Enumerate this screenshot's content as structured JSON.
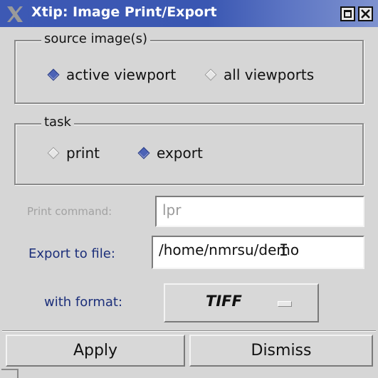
{
  "window": {
    "title": "Xtip: Image Print/Export",
    "icons": {
      "app": "x-logo-icon",
      "maximize": "maximize-icon",
      "close": "close-icon"
    }
  },
  "source_images": {
    "label": "source image(s)",
    "options": [
      {
        "label": "active viewport",
        "selected": true
      },
      {
        "label": "all viewports",
        "selected": false
      }
    ]
  },
  "task": {
    "label": "task",
    "options": [
      {
        "label": "print",
        "selected": false
      },
      {
        "label": "export",
        "selected": true
      }
    ]
  },
  "print_command": {
    "label": "Print command:",
    "value": "lpr",
    "enabled": false
  },
  "export_file": {
    "label": "Export to file:",
    "value": "/home/nmrsu/demo"
  },
  "format": {
    "label": "with format:",
    "value": "TIFF"
  },
  "buttons": {
    "apply": "Apply",
    "dismiss": "Dismiss"
  },
  "colors": {
    "titlebar": "#3d59b4",
    "window_bg": "#d6d6d6",
    "label_blue": "#1c2f7a",
    "radio_selected": "#4c63b6"
  }
}
